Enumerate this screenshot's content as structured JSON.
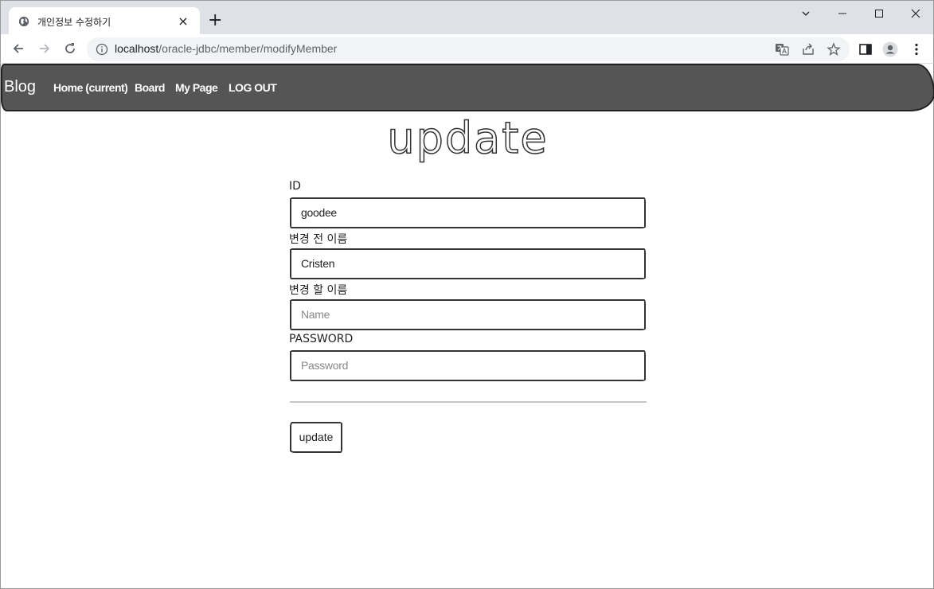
{
  "browser": {
    "tab_title": "개인정보 수정하기",
    "tab_close": "×",
    "new_tab": "+",
    "url_host": "localhost",
    "url_path": "/oracle-jdbc/member/modifyMember",
    "icons": [
      "globe-icon",
      "back-icon",
      "forward-icon",
      "reload-icon",
      "info-icon",
      "translate-icon",
      "share-icon",
      "star-icon",
      "side-panel-icon",
      "profile-icon",
      "menu-icon"
    ]
  },
  "navbar": {
    "brand": "Blog",
    "links": [
      "Home (current)",
      "Board",
      "My Page",
      "LOG OUT"
    ]
  },
  "page": {
    "title": "update"
  },
  "form": {
    "id_label": "ID",
    "id_value": "goodee",
    "old_name_label": "변경 전 이름",
    "old_name_value": "Cristen",
    "new_name_label": "변경 할 이름",
    "new_name_placeholder": "Name",
    "password_label": "PASSWORD",
    "password_placeholder": "Password",
    "submit_label": "update"
  }
}
